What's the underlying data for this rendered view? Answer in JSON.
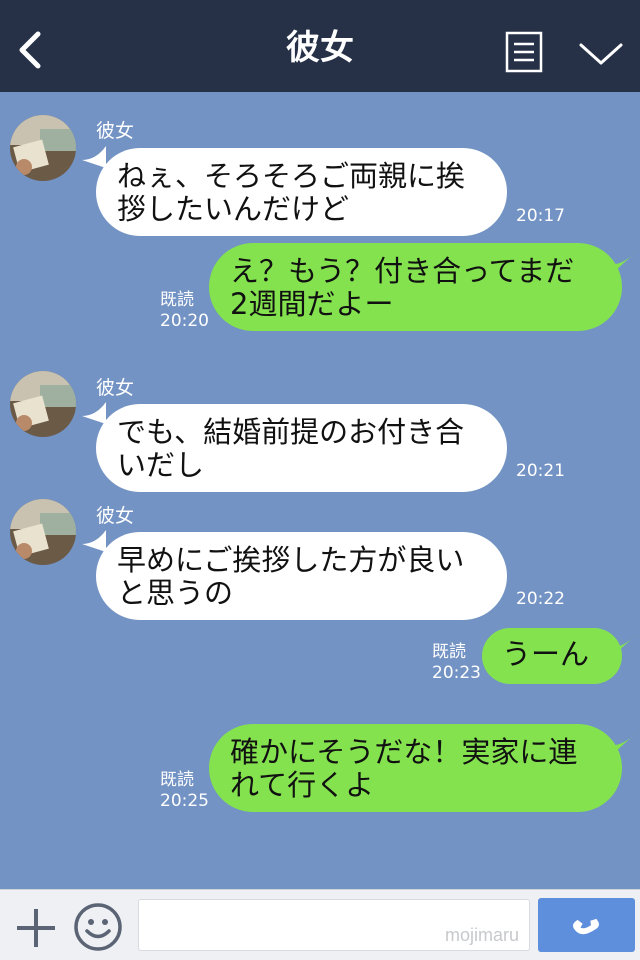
{
  "header": {
    "title": "彼女",
    "back_icon": "chevron-left-icon",
    "menu_icon": "menu-list-icon",
    "dropdown_icon": "chevron-down-icon",
    "background": "#263147"
  },
  "chat": {
    "background": "#7393c4",
    "messages": [
      {
        "side": "in",
        "sender": "彼女",
        "lines": [
          "ねぇ、そろそろご両親に挨",
          "拶したいんだけど"
        ],
        "time": "20:17"
      },
      {
        "side": "out",
        "read": "既読",
        "lines": [
          "え？もう？付き合ってまだ",
          "2週間だよー"
        ],
        "time": "20:20"
      },
      {
        "side": "in",
        "sender": "彼女",
        "lines": [
          "でも、結婚前提のお付き合",
          "いだし"
        ],
        "time": "20:21"
      },
      {
        "side": "in",
        "sender": "彼女",
        "lines": [
          "早めにご挨拶した方が良い",
          "と思うの"
        ],
        "time": "20:22"
      },
      {
        "side": "out",
        "read": "既読",
        "lines": [
          "うーん"
        ],
        "time": "20:23"
      },
      {
        "side": "out",
        "read": "既読",
        "lines": [
          "確かにそうだな！実家に連",
          "れて行くよ"
        ],
        "time": "20:25"
      }
    ]
  },
  "footer": {
    "plus_icon": "plus-icon",
    "emoji_icon": "smiley-icon",
    "input_placeholder": "",
    "watermark": "mojimaru",
    "call_icon": "phone-icon"
  },
  "colors": {
    "incoming_bubble": "#ffffff",
    "outgoing_bubble": "#84e24f",
    "call_button": "#5e8fdc"
  }
}
